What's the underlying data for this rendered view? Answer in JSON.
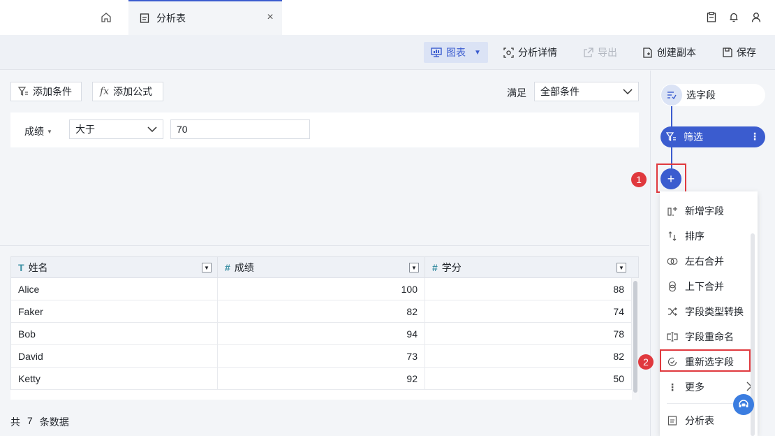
{
  "tabs": {
    "file_tab_label": "分析表",
    "close": "×"
  },
  "toolbar": {
    "chart": "图表",
    "analysis_detail": "分析详情",
    "export": "导出",
    "create_copy": "创建副本",
    "save": "保存"
  },
  "filter": {
    "add_condition": "添加条件",
    "add_formula": "添加公式",
    "satisfy_label": "满足",
    "satisfy_value": "全部条件",
    "field": "成绩",
    "operator": "大于",
    "value": "70"
  },
  "table": {
    "columns": [
      {
        "type_icon": "T",
        "label": "姓名"
      },
      {
        "type_icon": "#",
        "label": "成绩"
      },
      {
        "type_icon": "#",
        "label": "学分"
      }
    ],
    "rows": [
      [
        "Alice",
        "100",
        "88"
      ],
      [
        "Faker",
        "82",
        "74"
      ],
      [
        "Bob",
        "94",
        "78"
      ],
      [
        "David",
        "73",
        "82"
      ],
      [
        "Ketty",
        "92",
        "50"
      ]
    ]
  },
  "footer": {
    "prefix": "共",
    "count": "7",
    "suffix": "条数据"
  },
  "flow": {
    "select_fields": "选字段",
    "filter": "筛选",
    "more": "⋮",
    "add": "+"
  },
  "badges": {
    "one": "1",
    "two": "2"
  },
  "menu": {
    "items": [
      "新增字段",
      "排序",
      "左右合并",
      "上下合并",
      "字段类型转换",
      "字段重命名",
      "重新选字段",
      "更多",
      "分析表"
    ]
  },
  "colors": {
    "primary": "#3b5ccf",
    "highlight": "#e0393e",
    "teal": "#3b8fa3"
  }
}
